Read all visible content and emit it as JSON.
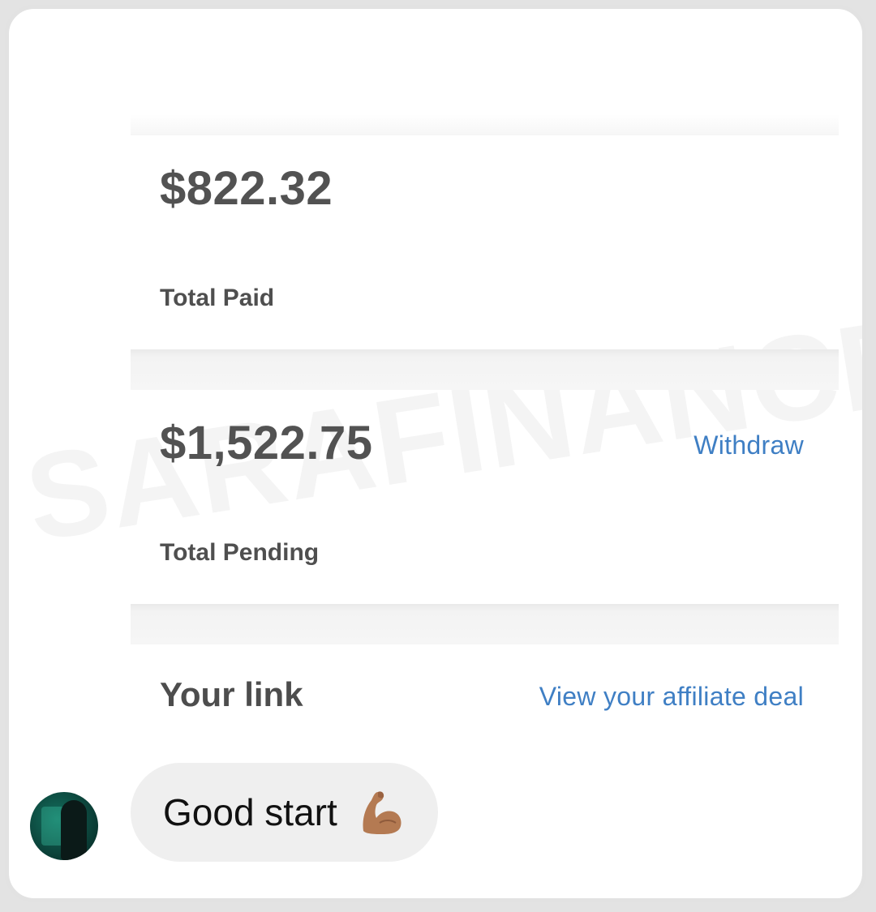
{
  "watermark": "SARAFINANCE",
  "earnings": {
    "total_paid": {
      "amount": "$822.32",
      "label": "Total Paid"
    },
    "total_pending": {
      "amount": "$1,522.75",
      "label": "Total Pending",
      "action": "Withdraw"
    }
  },
  "affiliate": {
    "title": "Your link",
    "deal_link": "View your affiliate deal"
  },
  "chat": {
    "message": "Good start",
    "emoji": "flexed-biceps-icon"
  },
  "colors": {
    "link": "#3f7fc4",
    "amount_text": "#525252",
    "bubble_bg": "#efefef"
  }
}
